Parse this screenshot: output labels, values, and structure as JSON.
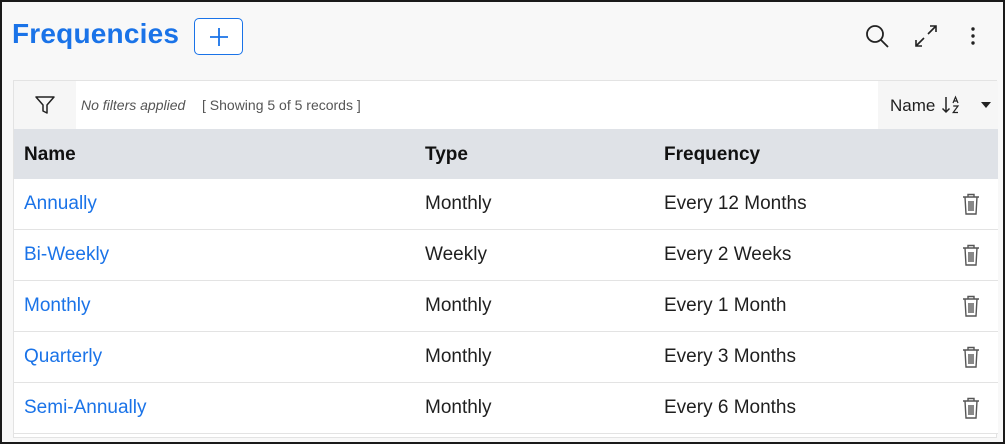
{
  "header": {
    "title": "Frequencies",
    "add_icon": "plus-icon",
    "actions": [
      "search-icon",
      "expand-icon",
      "more-vertical-icon"
    ]
  },
  "filter_bar": {
    "filter_icon": "filter-icon",
    "status": "No filters applied",
    "records": "[ Showing 5 of 5 records ]",
    "sort_label": "Name",
    "sort_icon": "sort-ascending-icon",
    "dropdown_icon": "caret-down-icon"
  },
  "table": {
    "columns": [
      "Name",
      "Type",
      "Frequency"
    ],
    "rows": [
      {
        "name": "Annually",
        "type": "Monthly",
        "frequency": "Every 12 Months"
      },
      {
        "name": "Bi-Weekly",
        "type": "Weekly",
        "frequency": "Every 2 Weeks"
      },
      {
        "name": "Monthly",
        "type": "Monthly",
        "frequency": "Every 1 Month"
      },
      {
        "name": "Quarterly",
        "type": "Monthly",
        "frequency": "Every 3 Months"
      },
      {
        "name": "Semi-Annually",
        "type": "Monthly",
        "frequency": "Every 6 Months"
      }
    ],
    "row_action_icon": "trash-icon"
  },
  "colors": {
    "accent": "#1a73e8",
    "header_bg": "#dfe2e7",
    "border": "#1a1a1a"
  }
}
